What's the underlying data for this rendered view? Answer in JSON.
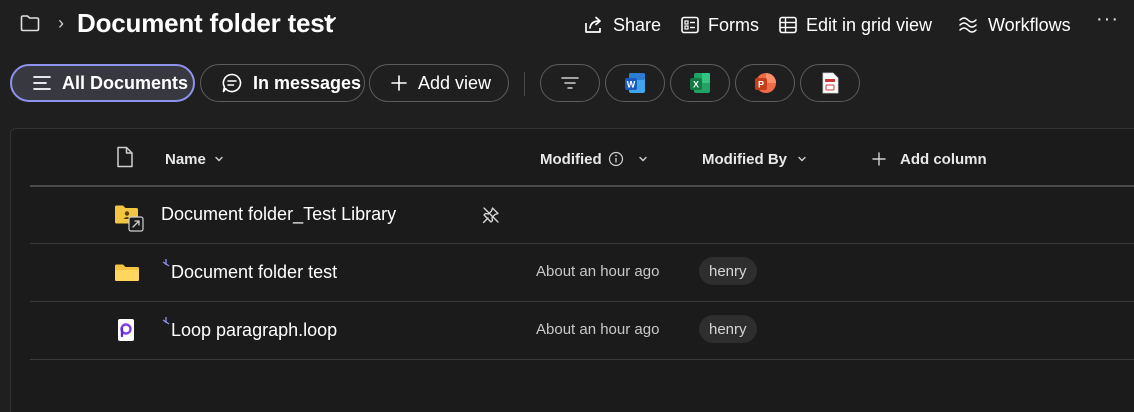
{
  "header": {
    "title": "Document folder test",
    "commands": [
      {
        "label": "Share",
        "icon": "share-icon"
      },
      {
        "label": "Forms",
        "icon": "forms-icon"
      },
      {
        "label": "Edit in grid view",
        "icon": "grid-icon"
      },
      {
        "label": "Workflows",
        "icon": "workflows-icon"
      }
    ],
    "more": "···"
  },
  "views": {
    "all_documents": "All Documents",
    "in_messages": "In messages",
    "add_view": "Add view"
  },
  "quick_actions": [
    "filter-icon",
    "word-icon",
    "excel-icon",
    "powerpoint-icon",
    "pdf-icon"
  ],
  "columns": {
    "name": "Name",
    "modified": "Modified",
    "modified_by": "Modified By",
    "add_column": "Add column"
  },
  "rows": [
    {
      "name": "Document folder_Test Library",
      "modified": "",
      "modified_by": "",
      "icon": "shared-folder-icon"
    },
    {
      "name": "Document folder test",
      "modified": "About an hour ago",
      "modified_by": "henry",
      "icon": "folder-icon"
    },
    {
      "name": "Loop paragraph.loop",
      "modified": "About an hour ago",
      "modified_by": "henry",
      "icon": "loop-icon"
    }
  ],
  "colors": {
    "background": "#1f1f1f",
    "accent": "#8f92ec",
    "folder": "#f4c542",
    "word": "#185abd",
    "excel": "#107c41",
    "powerpoint": "#c43e1c",
    "pdf": "#d13438"
  }
}
